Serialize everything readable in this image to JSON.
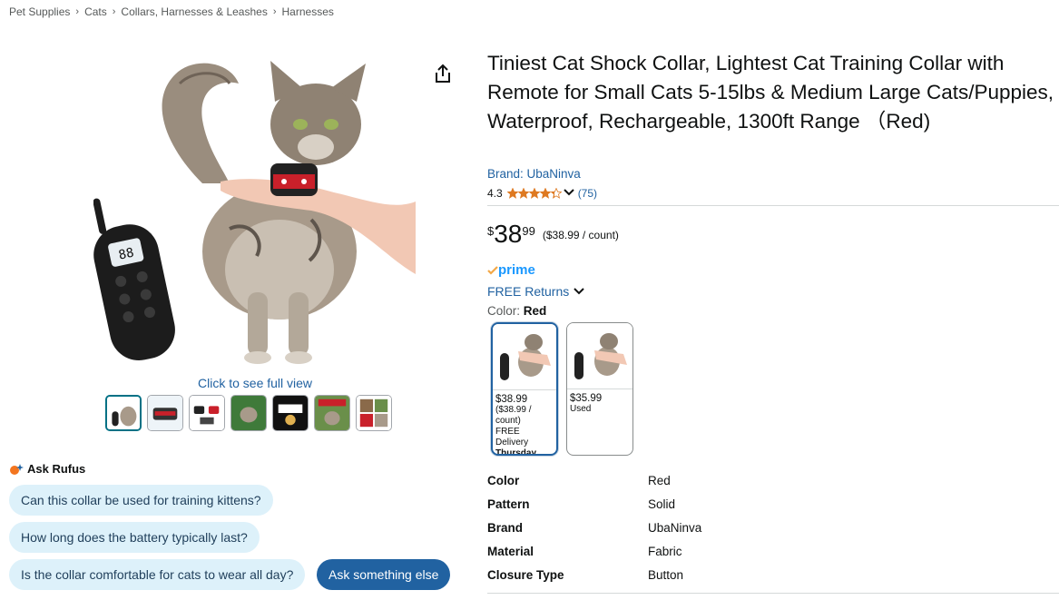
{
  "breadcrumb": [
    "Pet Supplies",
    "Cats",
    "Collars, Harnesses & Leashes",
    "Harnesses"
  ],
  "breadcrumb_separator": "›",
  "media": {
    "full_view_label": "Click to see full view",
    "remote_display": "88"
  },
  "rufus": {
    "title": "Ask Rufus",
    "questions": [
      "Can this collar be used for training kittens?",
      "How long does the battery typically last?",
      "Is the collar comfortable for cats to wear all day?"
    ],
    "ask_button": "Ask something else"
  },
  "product": {
    "title": "Tiniest Cat Shock Collar, Lightest Cat Training Collar with Remote for Small Cats 5-15lbs & Medium Large Cats/Puppies, Waterproof, Rechargeable, 1300ft Range （Red)",
    "brand": "Brand: UbaNinva",
    "rating": "4.3",
    "rating_value": 4.3,
    "rating_count": "(75)",
    "price": {
      "symbol": "$",
      "whole": "38",
      "fraction": "99",
      "per_unit": "($38.99 / count)"
    },
    "prime_label": "prime",
    "returns_label": "FREE Returns",
    "color_label": "Color:",
    "color_value": "Red",
    "swatches": [
      {
        "price": "$38.99",
        "per_unit": "($38.99 / count)",
        "delivery": "FREE Delivery",
        "delivery_day": "Thursday",
        "selected": true
      },
      {
        "price": "$35.99",
        "condition": "Used",
        "selected": false
      }
    ],
    "specs": [
      {
        "key": "Color",
        "value": "Red"
      },
      {
        "key": "Pattern",
        "value": "Solid"
      },
      {
        "key": "Brand",
        "value": "UbaNinva"
      },
      {
        "key": "Material",
        "value": "Fabric"
      },
      {
        "key": "Closure Type",
        "value": "Button"
      }
    ]
  },
  "colors": {
    "link": "#2162a1",
    "star": "#de7921",
    "prime": "#1a98ff",
    "rufus_chip": "#ddf1fa",
    "rufus_button": "#2162a1"
  }
}
